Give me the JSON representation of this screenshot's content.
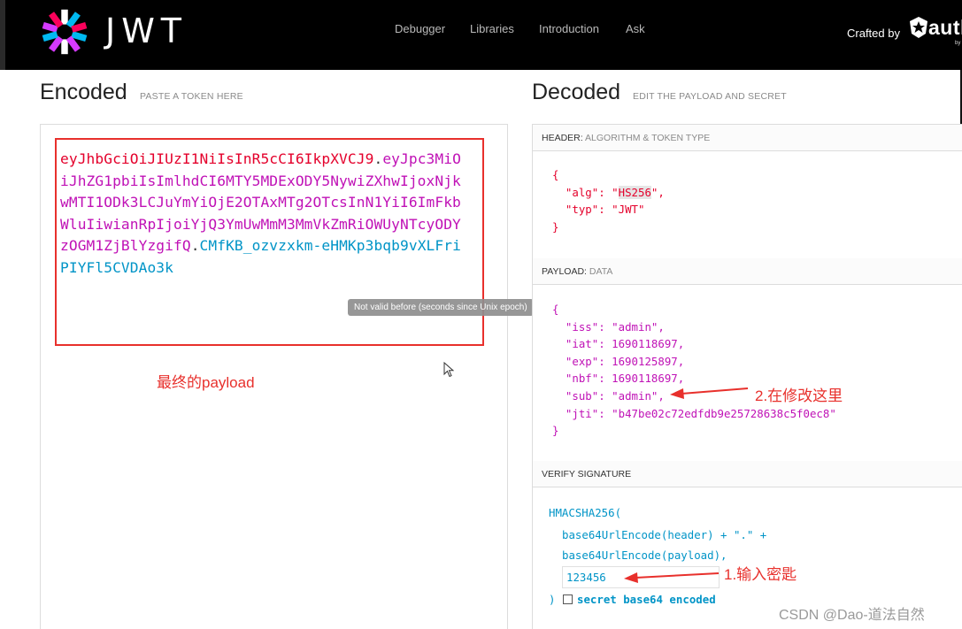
{
  "header": {
    "brand": "JWT",
    "nav": [
      "Debugger",
      "Libraries",
      "Introduction",
      "Ask"
    ],
    "crafted_by": "Crafted by",
    "partner_word": "auth",
    "partner_by": "by"
  },
  "encoded": {
    "title": "Encoded",
    "subtitle": "PASTE A TOKEN HERE",
    "token_header": "eyJhbGciOiJIUzI1NiIsInR5cCI6IkpXVCJ9",
    "token_payload": "eyJpc3MiOiJhZG1pbiIsImlhdCI6MTY5MDExODY5NywiZXhwIjoxNjkwMTI1ODk3LCJuYmYiOjE2OTAxMTg2OTcsInN1YiI6ImFkbWluIiwianRpIjoiYjQ3YmUwMmM3MmVkZmRiOWUyNTcyODYzOGM1ZjBlYzgifQ",
    "token_signature": "CMfKB_ozvzxkm-eHMKp3bqb9vXLFriPIYFl5CVDAo3k",
    "dot": ".",
    "tooltip": "Not valid before (seconds since Unix epoch)",
    "annotation": "最终的payload"
  },
  "decoded": {
    "title": "Decoded",
    "subtitle": "EDIT THE PAYLOAD AND SECRET",
    "header_section": {
      "label": "HEADER:",
      "sub": "ALGORITHM & TOKEN TYPE"
    },
    "header_json": {
      "alg": "HS256",
      "typ": "JWT"
    },
    "payload_section": {
      "label": "PAYLOAD:",
      "sub": "DATA"
    },
    "payload_json": {
      "iss": "admin",
      "iat": 1690118697,
      "exp": 1690125897,
      "nbf": 1690118697,
      "sub": "admin",
      "jti": "b47be02c72edfdb9e25728638c5f0ec8"
    },
    "verify_section": {
      "label": "VERIFY SIGNATURE"
    },
    "verify": {
      "fn": "HMACSHA256(",
      "line1": "base64UrlEncode(header) + \".\" +",
      "line2": "base64UrlEncode(payload),",
      "secret": "123456",
      "close": ")",
      "b64_label": "secret base64 encoded",
      "b64_checked": false
    },
    "annotation_modify": "2.在修改这里",
    "annotation_secret": "1.输入密匙"
  },
  "watermark": "CSDN @Dao-道法自然",
  "colors": {
    "header_red": "#e4002b",
    "payload_purple": "#c012b6",
    "signature_blue": "#0094c7",
    "annotation_red": "#e8302c"
  },
  "icons": [
    "jwt-logo-icon",
    "auth0-logo-icon",
    "mouse-cursor-icon"
  ]
}
